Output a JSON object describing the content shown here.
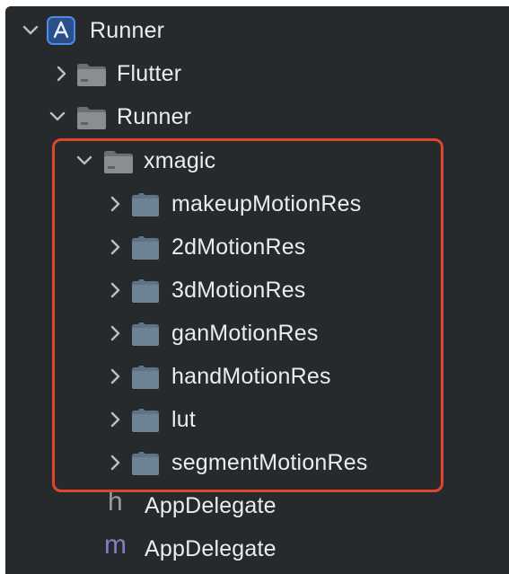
{
  "navigator": {
    "project": {
      "label": "Runner",
      "icon": "xcode-project-icon",
      "expanded": true
    },
    "flutter_group": {
      "label": "Flutter",
      "icon": "folder-icon",
      "expanded": false
    },
    "runner_group": {
      "label": "Runner",
      "icon": "folder-icon",
      "expanded": true
    },
    "xmagic_group": {
      "label": "xmagic",
      "icon": "folder-icon",
      "expanded": true
    },
    "xmagic_items": [
      {
        "label": "makeupMotionRes",
        "icon": "bundle-icon",
        "expanded": false
      },
      {
        "label": "2dMotionRes",
        "icon": "bundle-icon",
        "expanded": false
      },
      {
        "label": "3dMotionRes",
        "icon": "bundle-icon",
        "expanded": false
      },
      {
        "label": "ganMotionRes",
        "icon": "bundle-icon",
        "expanded": false
      },
      {
        "label": "handMotionRes",
        "icon": "bundle-icon",
        "expanded": false
      },
      {
        "label": "lut",
        "icon": "bundle-icon",
        "expanded": false
      },
      {
        "label": "segmentMotionRes",
        "icon": "bundle-icon",
        "expanded": false
      }
    ],
    "files": [
      {
        "label": "AppDelegate",
        "type_letter": "h",
        "icon": "header-file-icon"
      },
      {
        "label": "AppDelegate",
        "type_letter": "m",
        "icon": "objc-file-icon"
      }
    ]
  },
  "colors": {
    "background": "#272a2d",
    "text": "#ececec",
    "chevron": "#bdbdbd",
    "folder": "#6b6e73",
    "bundle": "#5f7384",
    "highlight": "#e0452f",
    "project_icon": "#3f78d8"
  }
}
